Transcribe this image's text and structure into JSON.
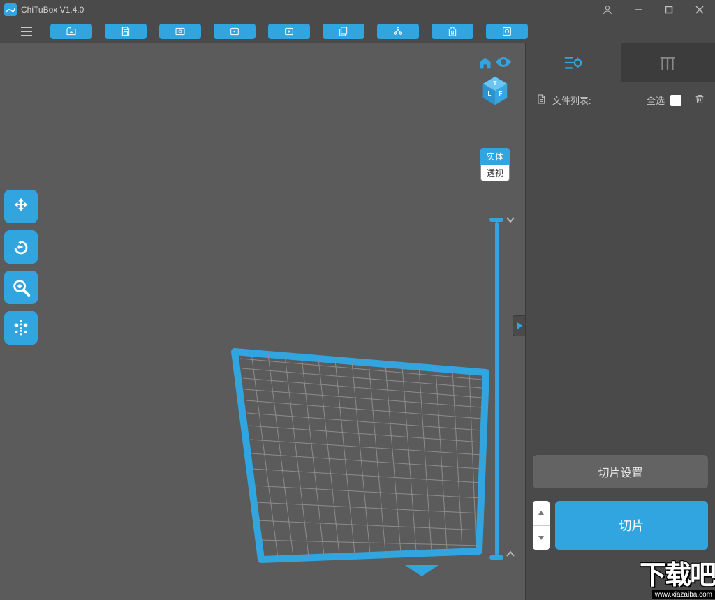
{
  "title": "ChiTuBox V1.4.0",
  "viewmode": {
    "solid": "实体",
    "perspective": "透视"
  },
  "sidebar": {
    "filelist_label": "文件列表:",
    "selectall_label": "全选",
    "slice_settings": "切片设置",
    "slice": "切片"
  },
  "watermark": {
    "text": "下载吧",
    "url": "www.xiazaiba.com"
  },
  "colors": {
    "accent": "#30a5e0"
  }
}
